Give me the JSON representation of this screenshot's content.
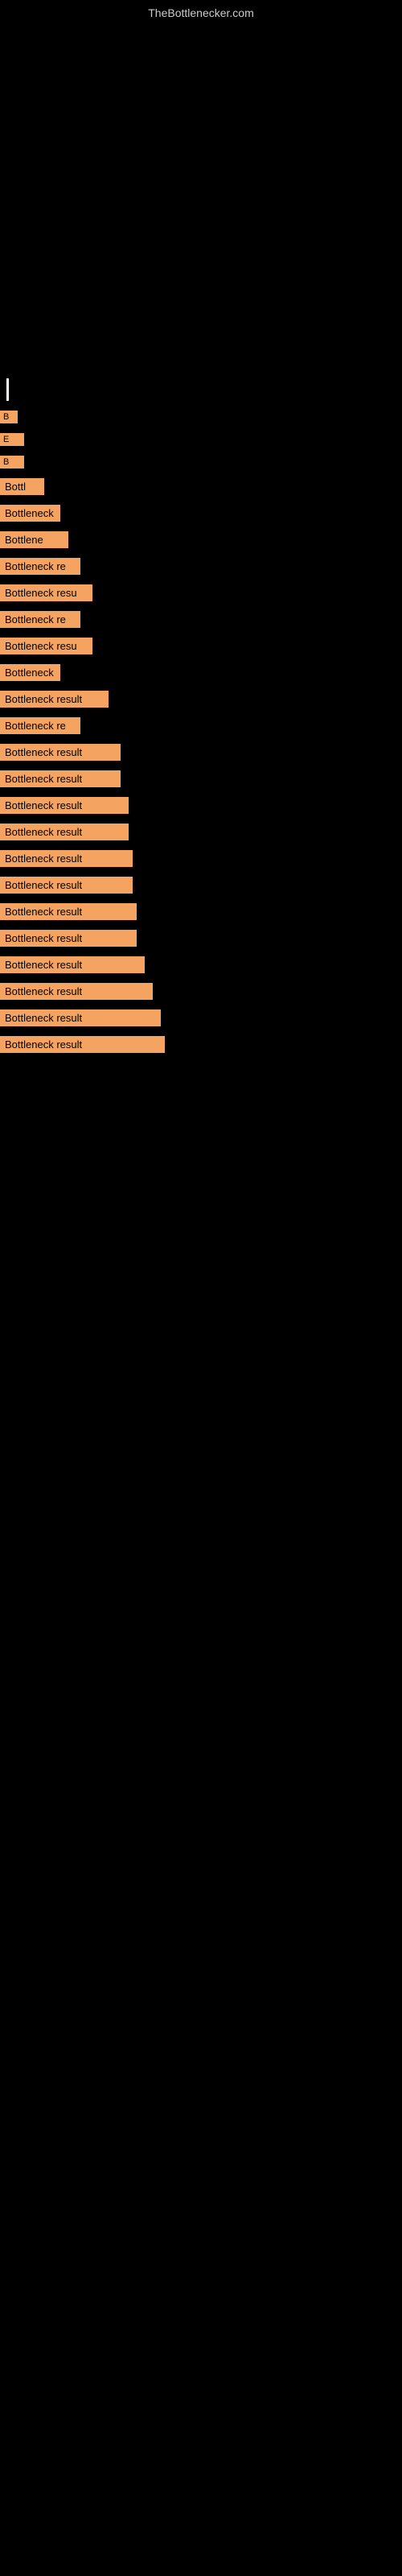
{
  "site": {
    "title": "TheBottlenecker.com"
  },
  "items": [
    {
      "id": 1,
      "label": "B",
      "size_class": "item-tiny"
    },
    {
      "id": 2,
      "label": "E",
      "size_class": "item-small"
    },
    {
      "id": 3,
      "label": "B",
      "size_class": "item-small"
    },
    {
      "id": 4,
      "label": "Bottl",
      "size_class": "item-s1"
    },
    {
      "id": 5,
      "label": "Bottleneck",
      "size_class": "item-s2"
    },
    {
      "id": 6,
      "label": "Bottlene",
      "size_class": "item-s3"
    },
    {
      "id": 7,
      "label": "Bottleneck re",
      "size_class": "item-m1"
    },
    {
      "id": 8,
      "label": "Bottleneck resu",
      "size_class": "item-m2"
    },
    {
      "id": 9,
      "label": "Bottleneck re",
      "size_class": "item-m1"
    },
    {
      "id": 10,
      "label": "Bottleneck resu",
      "size_class": "item-m2"
    },
    {
      "id": 11,
      "label": "Bottleneck",
      "size_class": "item-s2"
    },
    {
      "id": 12,
      "label": "Bottleneck result",
      "size_class": "item-l1"
    },
    {
      "id": 13,
      "label": "Bottleneck re",
      "size_class": "item-m1"
    },
    {
      "id": 14,
      "label": "Bottleneck result",
      "size_class": "item-l2"
    },
    {
      "id": 15,
      "label": "Bottleneck result",
      "size_class": "item-l2"
    },
    {
      "id": 16,
      "label": "Bottleneck result",
      "size_class": "item-l3"
    },
    {
      "id": 17,
      "label": "Bottleneck result",
      "size_class": "item-l3"
    },
    {
      "id": 18,
      "label": "Bottleneck result",
      "size_class": "item-l4"
    },
    {
      "id": 19,
      "label": "Bottleneck result",
      "size_class": "item-l4"
    },
    {
      "id": 20,
      "label": "Bottleneck result",
      "size_class": "item-l5"
    },
    {
      "id": 21,
      "label": "Bottleneck result",
      "size_class": "item-l5"
    },
    {
      "id": 22,
      "label": "Bottleneck result",
      "size_class": "item-xl1"
    },
    {
      "id": 23,
      "label": "Bottleneck result",
      "size_class": "item-xl2"
    },
    {
      "id": 24,
      "label": "Bottleneck result",
      "size_class": "item-xl3"
    },
    {
      "id": 25,
      "label": "Bottleneck result",
      "size_class": "item-xl4"
    }
  ]
}
